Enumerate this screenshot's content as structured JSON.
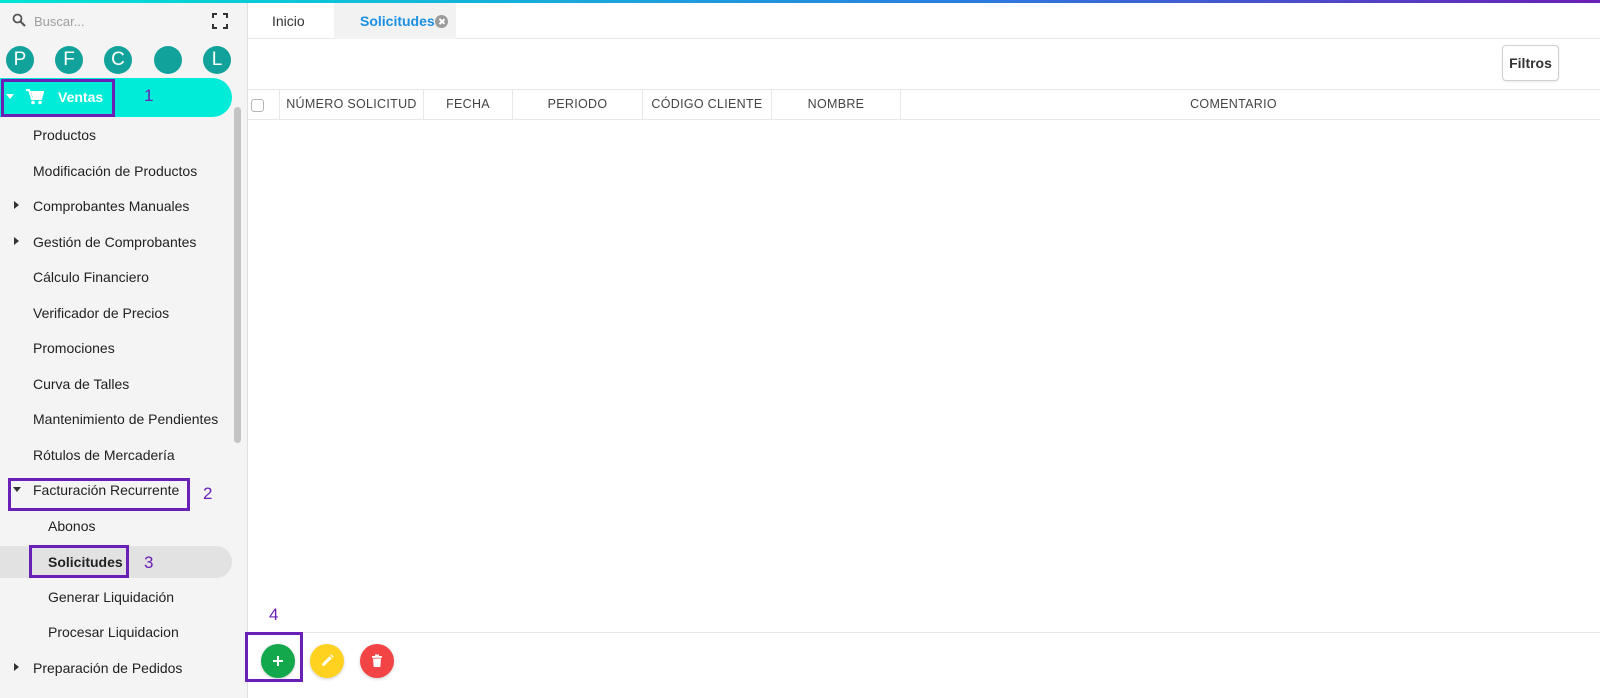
{
  "sidebar": {
    "search_placeholder": "Buscar...",
    "avatars": [
      "P",
      "F",
      "C",
      "",
      "L"
    ],
    "ventas_label": "Ventas",
    "items": {
      "productos": "Productos",
      "modificacion": "Modificación de Productos",
      "comprobantes_manuales": "Comprobantes Manuales",
      "gestion_comprobantes": "Gestión de Comprobantes",
      "calculo_financiero": "Cálculo Financiero",
      "verificador_precios": "Verificador de Precios",
      "promociones": "Promociones",
      "curva_talles": "Curva de Talles",
      "mantenimiento_pendientes": "Mantenimiento de Pendientes",
      "rotulos_mercaderia": "Rótulos de Mercadería",
      "facturacion_recurrente": "Facturación Recurrente",
      "abonos": "Abonos",
      "solicitudes": "Solicitudes",
      "generar_liquidacion": "Generar Liquidación",
      "procesar_liquidacion": "Procesar Liquidacion",
      "preparacion_pedidos": "Preparación de Pedidos"
    }
  },
  "tabs": {
    "inicio": "Inicio",
    "solicitudes": "Solicitudes"
  },
  "toolbar": {
    "filtros_label": "Filtros"
  },
  "table": {
    "columns": [
      "NÚMERO SOLICITUD",
      "FECHA",
      "PERIODO",
      "CÓDIGO CLIENTE",
      "NOMBRE",
      "COMENTARIO"
    ]
  },
  "annotations": [
    "1",
    "2",
    "3",
    "4"
  ],
  "colors": {
    "accent_cyan": "#00ecd9",
    "avatar_teal": "#11a39b",
    "active_tab_blue": "#1a8fe3",
    "annotation_purple": "#6a1fb5",
    "add_green": "#12a84b",
    "edit_yellow": "#ffd21f",
    "delete_red": "#f24444"
  },
  "icons": {
    "search": "search-icon",
    "fullscreen": "fullscreen-icon",
    "cart": "shopping-cart-icon",
    "close": "close-icon",
    "add": "plus-icon",
    "edit": "pencil-icon",
    "delete": "trash-icon"
  }
}
